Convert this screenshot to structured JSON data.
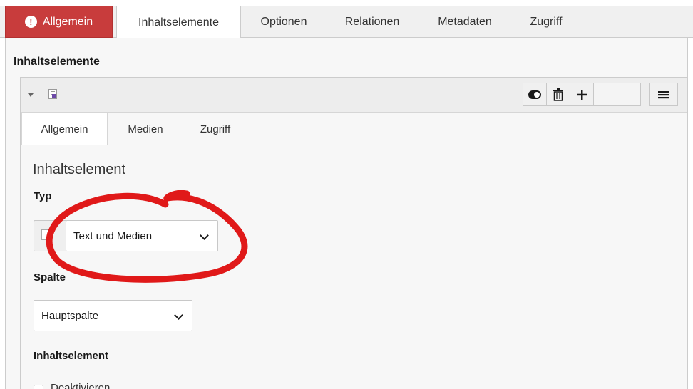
{
  "top_tabs": [
    {
      "label": "Allgemein",
      "state": "error"
    },
    {
      "label": "Inhaltselemente",
      "state": "selected"
    },
    {
      "label": "Optionen"
    },
    {
      "label": "Relationen"
    },
    {
      "label": "Metadaten"
    },
    {
      "label": "Zugriff"
    }
  ],
  "error_icon": "!",
  "section_title": "Inhaltselemente",
  "card": {
    "header_icon": "content-element-icon",
    "buttons": [
      "toggle-visibility-icon",
      "trash-icon",
      "plus-icon",
      "",
      "",
      "menu-icon"
    ]
  },
  "inner_tabs": [
    "Allgemein",
    "Medien",
    "Zugriff"
  ],
  "form": {
    "fieldset_title": "Inhaltselement",
    "type_label": "Typ",
    "type_value": "Text und Medien",
    "column_label": "Spalte",
    "column_value": "Hauptspalte",
    "element_label": "Inhaltselement",
    "disable_label": "Deaktivieren"
  },
  "colors": {
    "error_tab": "#c83c3c",
    "annotation": "#e01919"
  }
}
